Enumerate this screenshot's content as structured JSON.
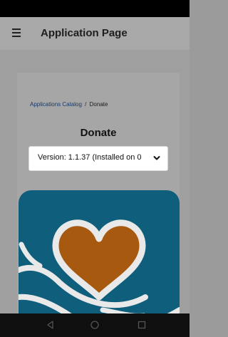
{
  "app_bar": {
    "title": "Application Page",
    "menu_icon": "hamburger-menu-icon"
  },
  "breadcrumb": {
    "parent": "Applications Catalog",
    "separator": "/",
    "current": "Donate"
  },
  "page": {
    "title": "Donate"
  },
  "version_select": {
    "selected": "Version: 1.1.37 (Installed on 0"
  },
  "nav_bar": {
    "buttons": [
      "back-icon",
      "home-icon",
      "recents-icon"
    ]
  },
  "colors": {
    "app_icon_background": "#0f5f7c",
    "heart": "#a85910",
    "link": "#173a6a"
  }
}
